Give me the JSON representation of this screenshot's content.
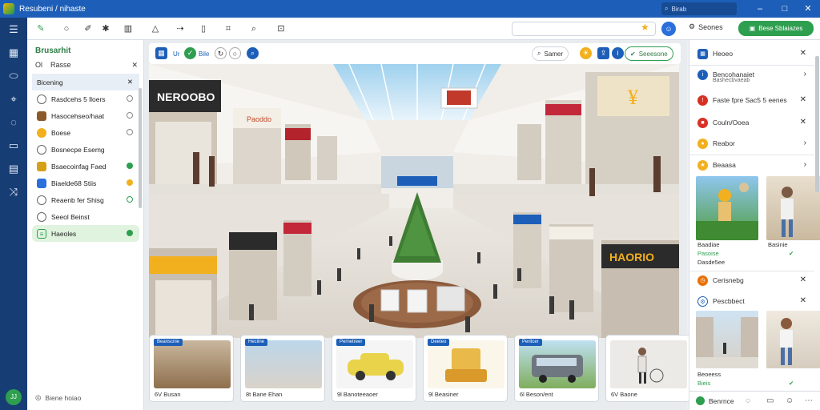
{
  "window": {
    "title": "Resubeni / nihaste",
    "search_label": "Birab"
  },
  "toolbar": {
    "settings_label": "Seones",
    "primary_label": "Bese Sblaiazes"
  },
  "left_panel": {
    "header": "Brusarhit",
    "sub_label_a": "Ol",
    "sub_label_b": "Rasse",
    "items": [
      {
        "label": "Bicening",
        "icon": "folder-icon",
        "color": "#e8eef6"
      },
      {
        "label": "Rasdcehs 5 lloers",
        "icon": "clock-icon",
        "color": "#ffffff"
      },
      {
        "label": "Hasocehseo/haat",
        "icon": "box-icon",
        "color": "#8b5a2b"
      },
      {
        "label": "Boese",
        "icon": "bag-icon",
        "color": "#f2b01e"
      },
      {
        "label": "Bosnecpe Esemg",
        "icon": "user-icon",
        "color": "#ffffff"
      },
      {
        "label": "Bsaecoinfag Faed",
        "icon": "tag-icon",
        "color": "#d4a017"
      },
      {
        "label": "Biaelde68 Stiis",
        "icon": "image-icon",
        "color": "#2a6fdb"
      },
      {
        "label": "Reaenb fer Shisg",
        "icon": "user-icon",
        "color": "#ffffff"
      },
      {
        "label": "Seeol Beinst",
        "icon": "circle-icon",
        "color": "#ffffff"
      },
      {
        "label": "Haeoles",
        "icon": "list-icon",
        "color": "#2e9e4f"
      }
    ],
    "footer": "Biene hoiao"
  },
  "main": {
    "tool_label_a": "Ur",
    "tool_label_b": "Bile",
    "pill_label": "Samer",
    "green_pill_label": "Seeesone",
    "thumbs": [
      {
        "tag": "Beanscnie",
        "caption": "6V Busan"
      },
      {
        "tag": "Hecilne",
        "caption": "8t Bane Ehan"
      },
      {
        "tag": "Pernetreer",
        "caption": "9l Banoteeaoer"
      },
      {
        "tag": "Deeteo",
        "caption": "9l Beasiner"
      },
      {
        "tag": "Peritcer",
        "caption": "6l Beson/ent"
      },
      {
        "tag": "",
        "caption": "6V Baone"
      }
    ],
    "storefront_signs": [
      "NEROOBO",
      "Paoddo",
      "HAORIO"
    ]
  },
  "right_panel": {
    "rows": [
      {
        "label": "Heoeo",
        "color": "#1d5fb8"
      },
      {
        "label": "Bencohanaiet",
        "sub": "Bashecbvaeab",
        "color": "#1d5fb8"
      },
      {
        "label": "Faste fpre Sac5 5 eenes",
        "color": "#d93025"
      },
      {
        "label": "Couln/Ooea",
        "color": "#d93025"
      },
      {
        "label": "Reabor",
        "color": "#f2b01e"
      },
      {
        "label": "Beaasa",
        "color": "#f2b01e"
      },
      {
        "label": "Cerisnebg",
        "color": "#e8710a"
      },
      {
        "label": "Pescbbect",
        "color": "#1d5fb8"
      }
    ],
    "card_captions": [
      {
        "a": "Baadiae",
        "b": "Pasoise",
        "c": "Dasde5ee",
        "d": "Basinie"
      },
      {
        "a": "Beoeess",
        "b": "Bieis",
        "c": "",
        "d": ""
      }
    ],
    "footer_label": "Benrnce"
  }
}
